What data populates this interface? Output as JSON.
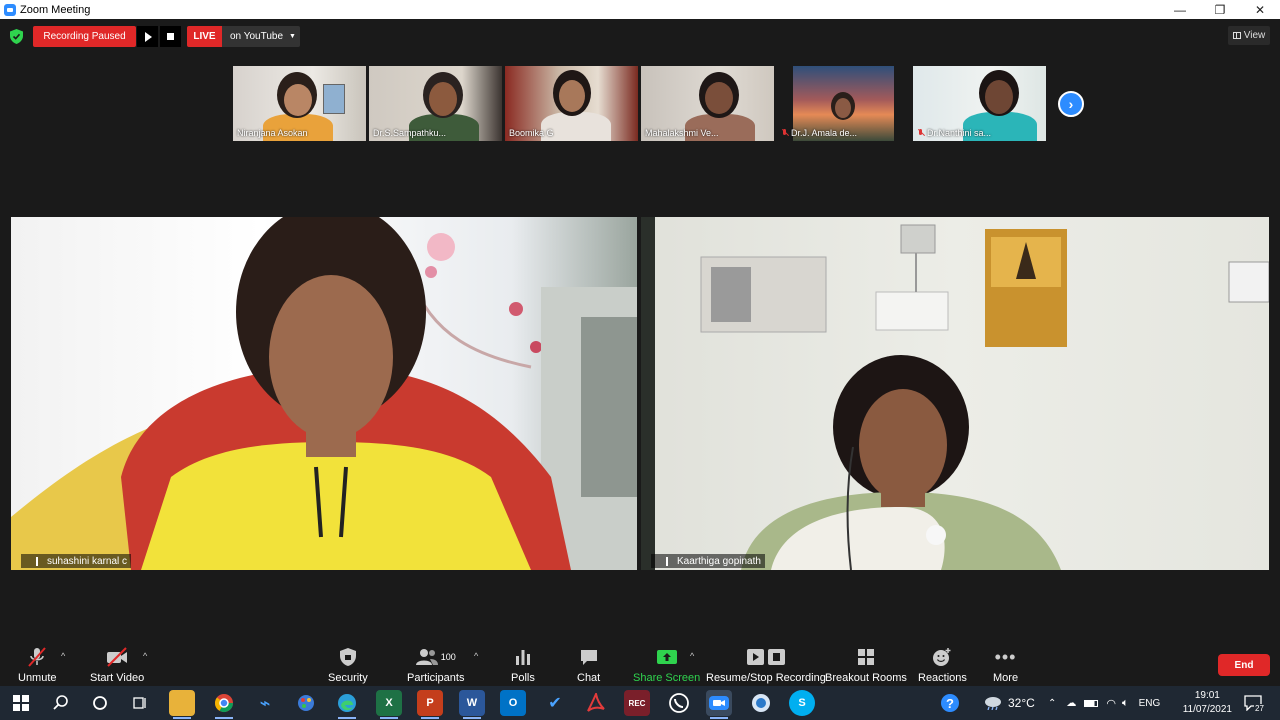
{
  "window": {
    "title": "Zoom Meeting",
    "controls": [
      "—",
      "❐",
      "✕"
    ]
  },
  "recording": {
    "status_label": "Recording Paused"
  },
  "live": {
    "badge": "LIVE",
    "destination": "on YouTube"
  },
  "view": {
    "label": "View"
  },
  "participants_strip": [
    {
      "name": "Niranjana Asokan",
      "muted": false
    },
    {
      "name": "Dr.S.Sampathku...",
      "muted": false
    },
    {
      "name": "Boomika G",
      "muted": false
    },
    {
      "name": "Mahalakshmi Ve...",
      "muted": false
    },
    {
      "name": "Dr.J. Amala de...",
      "muted": true
    },
    {
      "name": "Dr.Nanthini sa...",
      "muted": true
    }
  ],
  "main_tiles": [
    {
      "name": "suhashini karnal c",
      "muted": true
    },
    {
      "name": "Kaarthiga gopinath",
      "muted": true
    }
  ],
  "toolbar": {
    "unmute": "Unmute",
    "start_video": "Start Video",
    "security": "Security",
    "participants": "Participants",
    "participants_count": "100",
    "polls": "Polls",
    "chat": "Chat",
    "share_screen": "Share Screen",
    "recording": "Resume/Stop Recording",
    "breakout": "Breakout Rooms",
    "reactions": "Reactions",
    "more": "More",
    "end": "End"
  },
  "taskbar": {
    "weather": "32°C",
    "language": "ENG",
    "time": "19:01",
    "date": "11/07/2021",
    "notifications": "27"
  },
  "colors": {
    "accent": "#2d8cff",
    "danger": "#e02828",
    "share": "#2fd34e",
    "background": "#1a1a1a"
  }
}
